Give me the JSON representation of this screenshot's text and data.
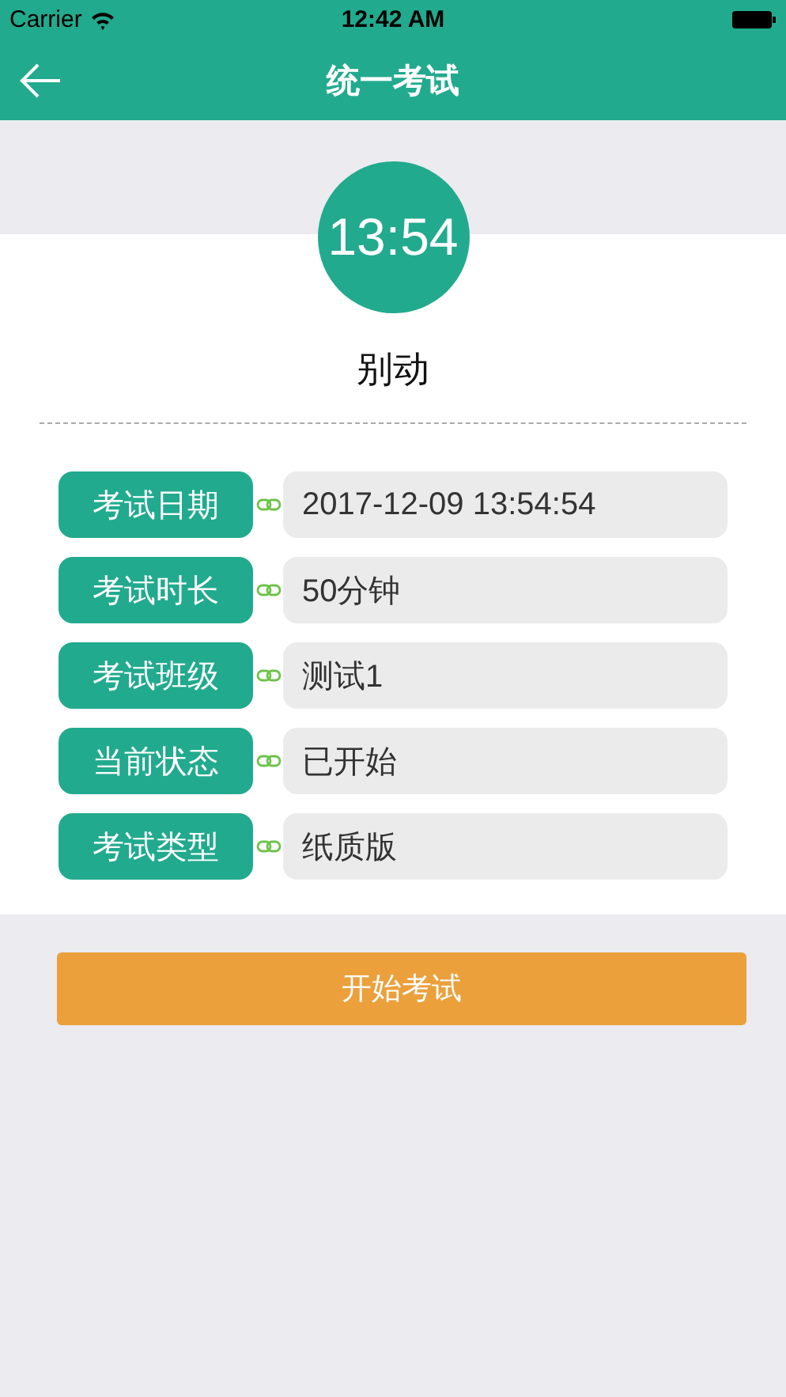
{
  "status_bar": {
    "carrier": "Carrier",
    "time": "12:42 AM"
  },
  "nav_bar": {
    "title": "统一考试"
  },
  "timer": "13:54",
  "message": "别动",
  "fields": [
    {
      "label": "考试日期",
      "value": "2017-12-09 13:54:54"
    },
    {
      "label": "考试时长",
      "value": "50分钟"
    },
    {
      "label": "考试班级",
      "value": "测试1"
    },
    {
      "label": "当前状态",
      "value": "已开始"
    },
    {
      "label": "考试类型",
      "value": "纸质版"
    }
  ],
  "start_button": "开始考试"
}
